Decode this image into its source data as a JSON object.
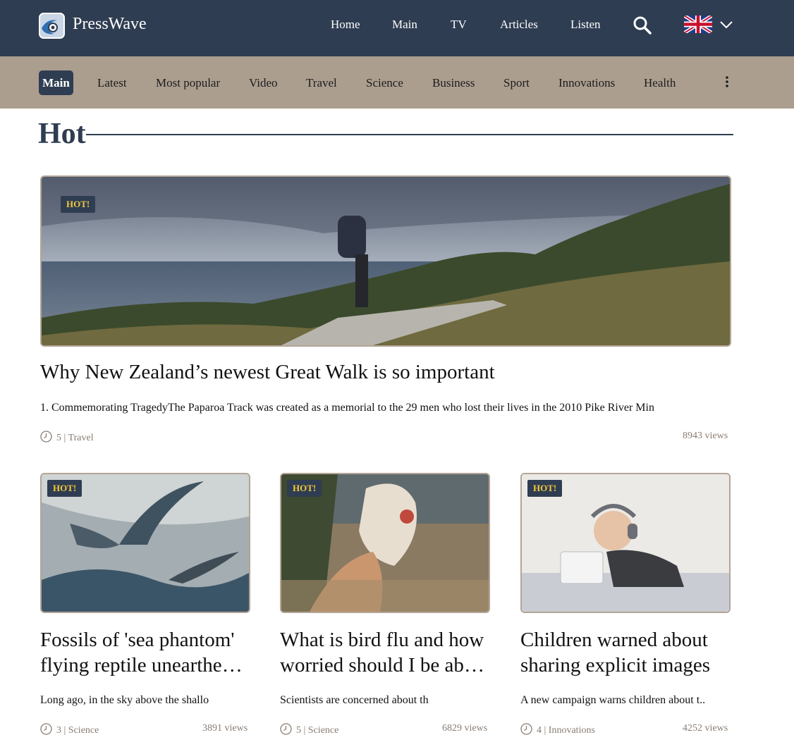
{
  "brand": {
    "name": "PressWave"
  },
  "top_nav": [
    {
      "label": "Home"
    },
    {
      "label": "Main"
    },
    {
      "label": "TV"
    },
    {
      "label": "Articles"
    },
    {
      "label": "Listen"
    }
  ],
  "icons": {
    "search": "search-icon",
    "flag": "uk-flag-icon",
    "dropdown": "chevron-down-icon",
    "more": "more-vertical-icon",
    "clock": "clock-icon"
  },
  "categories": [
    {
      "label": "Main",
      "active": true
    },
    {
      "label": "Latest"
    },
    {
      "label": "Most popular"
    },
    {
      "label": "Video"
    },
    {
      "label": "Travel"
    },
    {
      "label": "Science"
    },
    {
      "label": "Business"
    },
    {
      "label": "Sport"
    },
    {
      "label": "Innovations"
    },
    {
      "label": "Health"
    }
  ],
  "section": {
    "title": "Hot"
  },
  "hero": {
    "badge": "HOT!",
    "title": "Why New Zealand’s newest Great Walk is so important",
    "excerpt": "1. Commemorating TragedyThe Paparoa Track was created as a memorial to the 29 men who lost their lives in the 2010 Pike River Min",
    "meta": "5 | Travel",
    "views": "8943 views"
  },
  "cards": [
    {
      "badge": "HOT!",
      "title": "Fossils of 'sea phantom' flying reptile unearthed in Chile",
      "excerpt": "Long ago, in the sky above the shallo",
      "meta": "3 | Science",
      "views": "3891 views"
    },
    {
      "badge": "HOT!",
      "title": "What is bird flu and how worried should I be about it?",
      "excerpt": "Scientists are concerned about th",
      "meta": "5 | Science",
      "views": "6829 views"
    },
    {
      "badge": "HOT!",
      "title": "Children warned about sharing explicit images",
      "excerpt": "A new campaign warns children about t..",
      "meta": "4 | Innovations",
      "views": "4252 views"
    }
  ],
  "colors": {
    "header_bg": "#2f3d52",
    "category_bg": "#ab9e8f",
    "badge_text": "#f1c83d",
    "meta_text": "#8a7c70"
  }
}
